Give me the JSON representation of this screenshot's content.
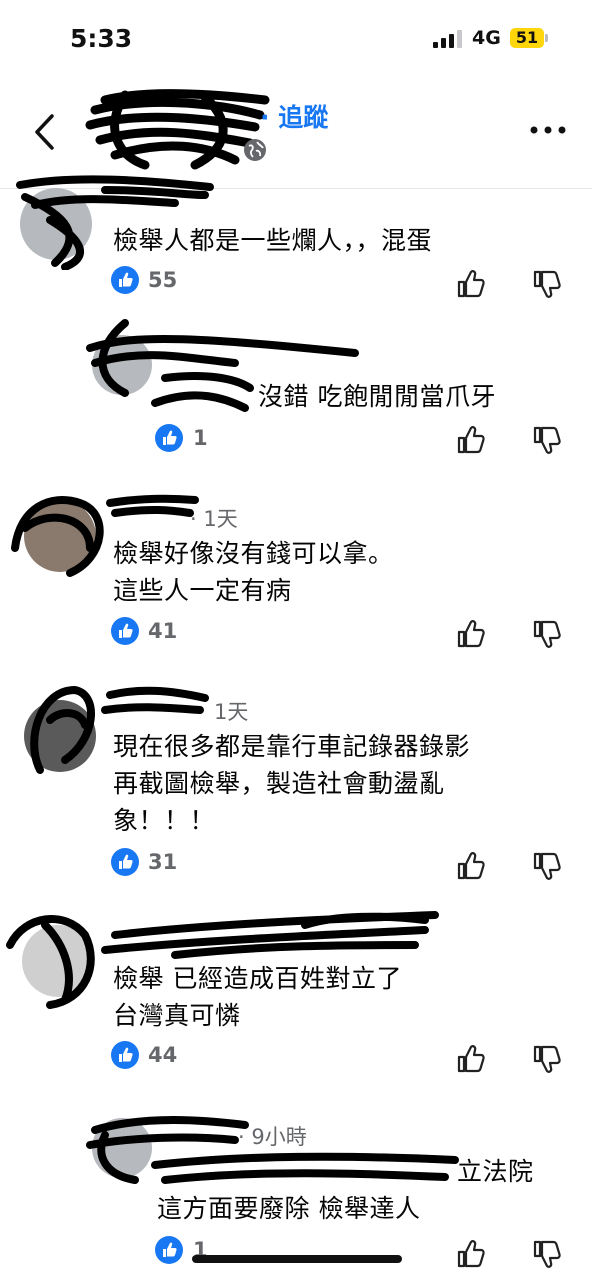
{
  "status_bar": {
    "time": "5:33",
    "network": "4G",
    "battery": "51"
  },
  "header": {
    "follow_label": "· 追蹤"
  },
  "comments": [
    {
      "text_lines": [
        "檢舉人都是一些爛人，，混蛋"
      ],
      "likes": "55"
    },
    {
      "reply": true,
      "text_lines": [
        "沒錯 吃飽閒閒當爪牙"
      ],
      "likes": "1"
    },
    {
      "time": "· 1天",
      "text_lines": [
        "檢舉好像沒有錢可以拿。",
        "這些人一定有病"
      ],
      "likes": "41"
    },
    {
      "time": "1天",
      "text_lines": [
        "現在很多都是靠行車記錄器錄影",
        "再截圖檢舉，製造社會動盪亂",
        "象！！！"
      ],
      "likes": "31"
    },
    {
      "text_lines": [
        "檢舉 已經造成百姓對立了",
        "台灣真可憐"
      ],
      "likes": "44"
    },
    {
      "reply": true,
      "time": "· 9小時",
      "text_lines": [
        "立法院",
        "這方面要廢除 檢舉達人"
      ],
      "likes": "1"
    }
  ],
  "colors": {
    "accent": "#1877f2",
    "meta": "#65676b",
    "battery": "#ffd60a"
  }
}
